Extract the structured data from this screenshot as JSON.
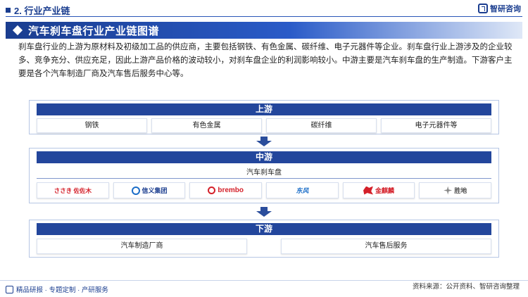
{
  "header": {
    "section": "2. 行业产业链",
    "brand": "智研咨询",
    "brand_icon": "zhiyan-logo-icon"
  },
  "title": "汽车刹车盘行业产业链图谱",
  "intro": "刹车盘行业的上游为原材料及初级加工品的供应商，主要包括钢铁、有色金属、碳纤维、电子元器件等企业。刹车盘行业上游涉及的企业较多、竞争充分、供应充足，因此上游产品价格的波动较小，对刹车盘企业的利润影响较小。中游主要是汽车刹车盘的生产制造。下游客户主要是各个汽车制造厂商及汽车售后服务中心等。",
  "upstream": {
    "label": "上游",
    "items": [
      "钢铁",
      "有色金属",
      "碳纤维",
      "电子元器件等"
    ]
  },
  "midstream": {
    "label": "中游",
    "sub_label": "汽车刹车盘",
    "logos": [
      {
        "text": "ささき 佐佐木",
        "icon": "sasaki-logo"
      },
      {
        "text": "信义集团",
        "sub": "XINYI GROUP",
        "icon": "xinyi-logo"
      },
      {
        "text": "brembo",
        "icon": "brembo-logo"
      },
      {
        "text": "东风",
        "icon": "dongfeng-logo"
      },
      {
        "text": "金麒麟",
        "sub": "GOLD PHOENIX",
        "icon": "golden-qilin-logo"
      },
      {
        "text": "胜地",
        "sub": "WINHERE",
        "icon": "winhere-logo"
      }
    ]
  },
  "downstream": {
    "label": "下游",
    "items": [
      "汽车制造厂商",
      "汽车售后服务"
    ]
  },
  "footer": {
    "left": "精品研报 · 专题定制 · 产研服务",
    "right": "资料来源：公开资料、智研咨询整理"
  },
  "colors": {
    "primary": "#1a3d8f",
    "panel_head": "#23469c",
    "accent_red": "#d4202a"
  }
}
